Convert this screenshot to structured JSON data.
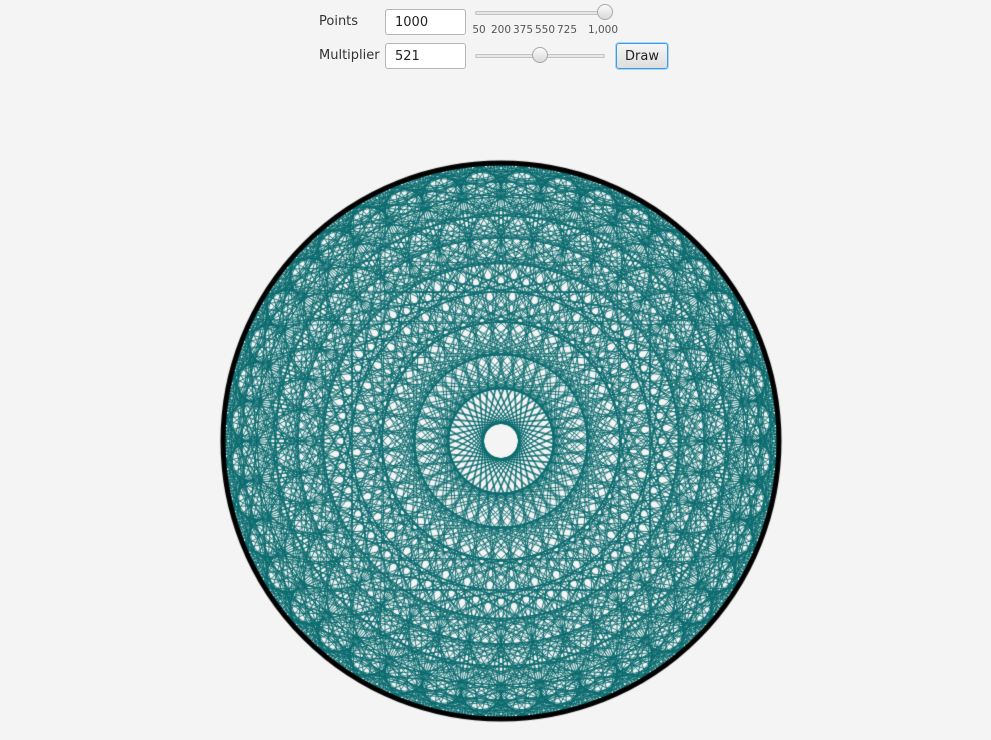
{
  "controls": {
    "points": {
      "label": "Points",
      "value": "1000",
      "slider": {
        "min": 50,
        "max": 1000,
        "value": 1000,
        "tick_labels": [
          "50",
          "200",
          "375",
          "550",
          "725",
          "1,000"
        ]
      }
    },
    "multiplier": {
      "label": "Multiplier",
      "value": "521",
      "slider": {
        "value_fraction": 0.5
      }
    },
    "draw_label": "Draw"
  },
  "drawing": {
    "points": 1000,
    "multiplier": 521,
    "line_color": "#0a6b6e",
    "circle_color": "#000000",
    "background_color": "#f4f4f4"
  }
}
